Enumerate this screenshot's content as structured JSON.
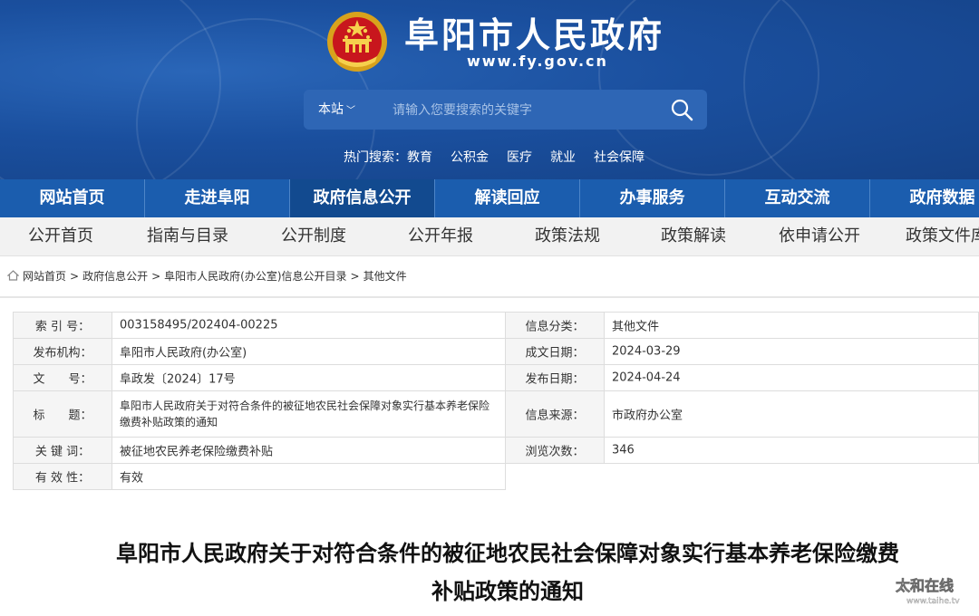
{
  "header": {
    "title": "阜阳市人民政府",
    "url": "www.fy.gov.cn",
    "search": {
      "scope": "本站",
      "placeholder": "请输入您要搜索的关键字"
    },
    "hot": {
      "label": "热门搜索：",
      "items": [
        "教育",
        "公积金",
        "医疗",
        "就业",
        "社会保障"
      ]
    }
  },
  "main_nav": {
    "items": [
      "网站首页",
      "走进阜阳",
      "政府信息公开",
      "解读回应",
      "办事服务",
      "互动交流",
      "政府数据"
    ],
    "active_index": 2
  },
  "sub_nav": {
    "items": [
      "公开首页",
      "指南与目录",
      "公开制度",
      "公开年报",
      "政策法规",
      "政策解读",
      "依申请公开",
      "政策文件库"
    ]
  },
  "breadcrumb": [
    "网站首页",
    "政府信息公开",
    "阜阳市人民政府(办公室)信息公开目录",
    "其他文件"
  ],
  "info": {
    "index_label": "索 引 号：",
    "index_value": "003158495/202404-00225",
    "category_label": "信息分类：",
    "category_value": "其他文件",
    "publisher_label": "发布机构：",
    "publisher_value": "阜阳市人民政府(办公室)",
    "created_label": "成文日期：",
    "created_value": "2024-03-29",
    "docno_label": "文　　号：",
    "docno_value": "阜政发〔2024〕17号",
    "published_label": "发布日期：",
    "published_value": "2024-04-24",
    "title_label": "标　　题：",
    "title_value": "阜阳市人民政府关于对符合条件的被征地农民社会保障对象实行基本养老保险缴费补贴政策的通知",
    "source_label": "信息来源：",
    "source_value": "市政府办公室",
    "keyword_label": "关 键 词：",
    "keyword_value": "被征地农民养老保险缴费补贴",
    "views_label": "浏览次数：",
    "views_value": "346",
    "validity_label": "有 效 性：",
    "validity_value": "有效"
  },
  "headline": {
    "line1": "阜阳市人民政府关于对符合条件的被征地农民社会保障对象实行基本养老保险缴费",
    "line2": "补贴政策的通知"
  },
  "watermark": {
    "text": "太和在线",
    "sub": "www.taihe.tv"
  },
  "colors": {
    "header_bg": "#1a4f9e",
    "nav_bg": "#1b5dae",
    "nav_active": "#124a8f",
    "subnav_bg": "#f2f2f2"
  }
}
